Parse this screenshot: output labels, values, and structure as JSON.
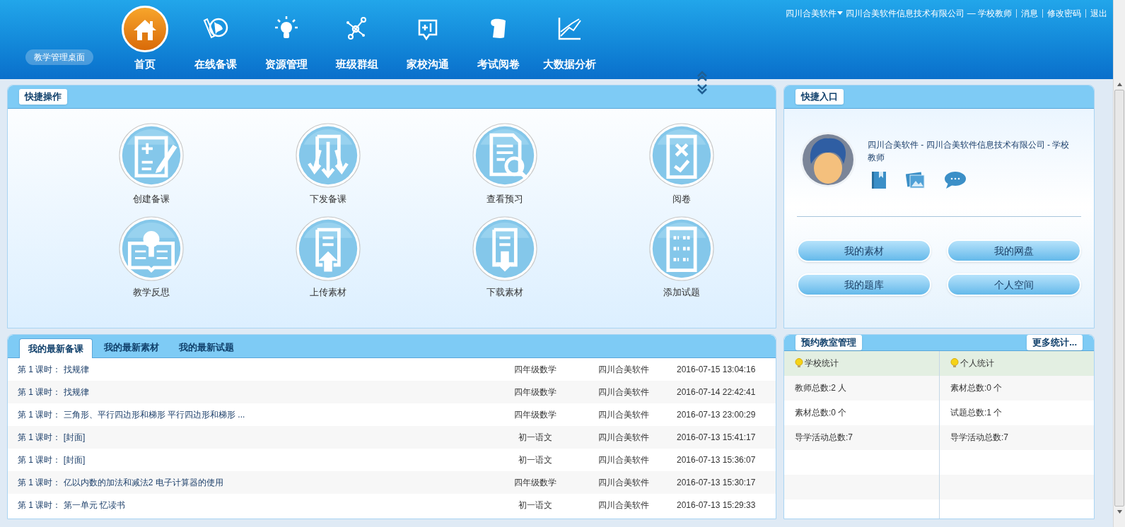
{
  "header": {
    "badge": "教学管理桌面",
    "nav": [
      {
        "label": "首页",
        "selected": true
      },
      {
        "label": "在线备课",
        "selected": false
      },
      {
        "label": "资源管理",
        "selected": false
      },
      {
        "label": "班级群组",
        "selected": false
      },
      {
        "label": "家校沟通",
        "selected": false
      },
      {
        "label": "考试阅卷",
        "selected": false
      },
      {
        "label": "大数据分析",
        "selected": false
      }
    ],
    "user_menu": "四川合美软件",
    "user_info": "四川合美软件信息技术有限公司 — 学校教师",
    "links": [
      "消息",
      "修改密码",
      "退出"
    ]
  },
  "quick_ops": {
    "title": "快捷操作",
    "items": [
      "创建备课",
      "下发备课",
      "查看预习",
      "阅卷",
      "教学反思",
      "上传素材",
      "下载素材",
      "添加试题"
    ]
  },
  "quick_entry": {
    "title": "快捷入口",
    "profile": "四川合美软件 - 四川合美软件信息技术有限公司 - 学校教师",
    "buttons": [
      "我的素材",
      "我的网盘",
      "我的题库",
      "个人空间"
    ]
  },
  "recent": {
    "tabs": [
      {
        "label": "我的最新备课",
        "selected": true
      },
      {
        "label": "我的最新素材",
        "selected": false
      },
      {
        "label": "我的最新试题",
        "selected": false
      }
    ],
    "rows": [
      {
        "title": "第 1 课时： 找规律",
        "subject": "四年级数学",
        "author": "四川合美软件",
        "time": "2016-07-15 13:04:16"
      },
      {
        "title": "第 1 课时： 找规律",
        "subject": "四年级数学",
        "author": "四川合美软件",
        "time": "2016-07-14 22:42:41"
      },
      {
        "title": "第 1 课时： 三角形、平行四边形和梯形 平行四边形和梯形 ...",
        "subject": "四年级数学",
        "author": "四川合美软件",
        "time": "2016-07-13 23:00:29"
      },
      {
        "title": "第 1 课时： [封面]",
        "subject": "初一语文",
        "author": "四川合美软件",
        "time": "2016-07-13 15:41:17"
      },
      {
        "title": "第 1 课时： [封面]",
        "subject": "初一语文",
        "author": "四川合美软件",
        "time": "2016-07-13 15:36:07"
      },
      {
        "title": "第 1 课时： 亿以内数的加法和减法2 电子计算器的使用",
        "subject": "四年级数学",
        "author": "四川合美软件",
        "time": "2016-07-13 15:30:17"
      },
      {
        "title": "第 1 课时： 第一单元 忆读书",
        "subject": "初一语文",
        "author": "四川合美软件",
        "time": "2016-07-13 15:29:33"
      }
    ]
  },
  "stats": {
    "title": "预约教室管理",
    "more": "更多统计...",
    "columns": [
      {
        "heading": "学校统计",
        "items": [
          "教师总数:2 人",
          "素材总数:0 个",
          "导学活动总数:7"
        ]
      },
      {
        "heading": "个人统计",
        "items": [
          "素材总数:0 个",
          "试题总数:1 个",
          "导学活动总数:7"
        ]
      }
    ]
  }
}
